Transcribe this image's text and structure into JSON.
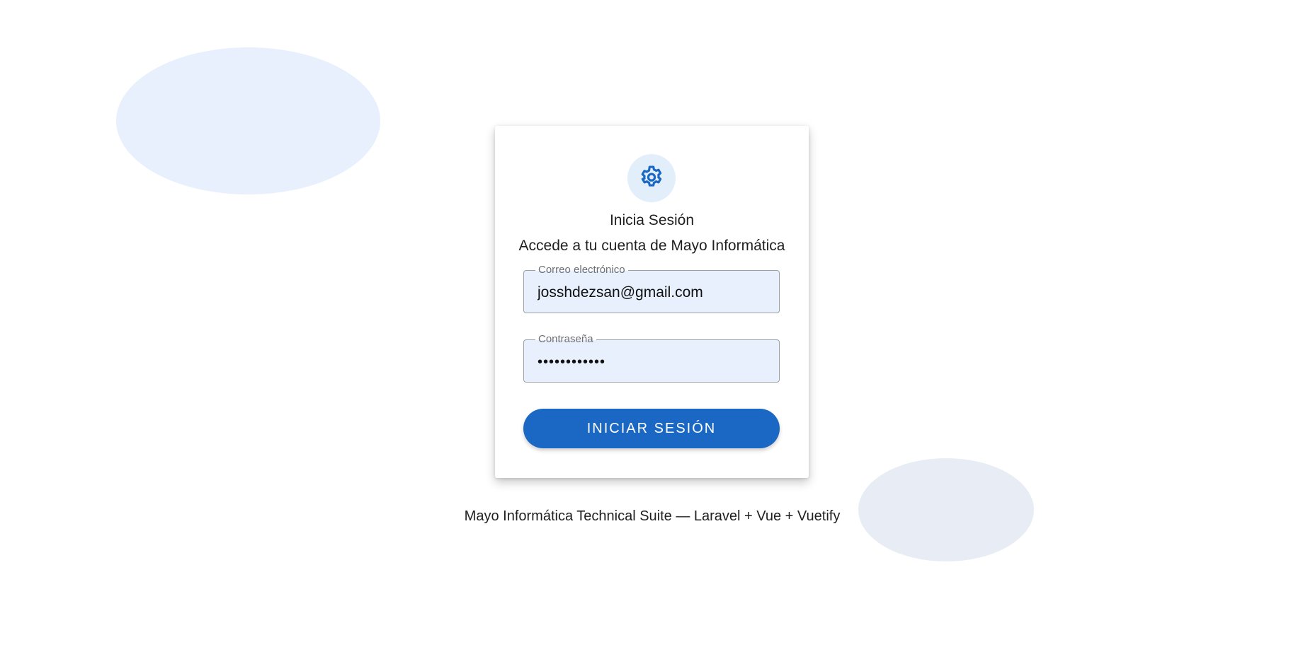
{
  "login": {
    "title": "Inicia Sesión",
    "subtitle": "Accede a tu cuenta de Mayo Informática",
    "email": {
      "label": "Correo electrónico",
      "value": "josshdezsan@gmail.com"
    },
    "password": {
      "label": "Contraseña",
      "value": "••••••••••••"
    },
    "submit_label": "INICIAR SESIÓN"
  },
  "logo": {
    "icon": "gear-icon"
  },
  "footer": {
    "text": "Mayo Informática Technical Suite — Laravel + Vue + Vuetify"
  },
  "colors": {
    "primary": "#1a68c3",
    "field_background": "#e8f0fd",
    "logo_circle": "#e3eefb",
    "blob_light_blue": "#e8f0fd",
    "blob_light_gray": "#e8ecf4"
  }
}
